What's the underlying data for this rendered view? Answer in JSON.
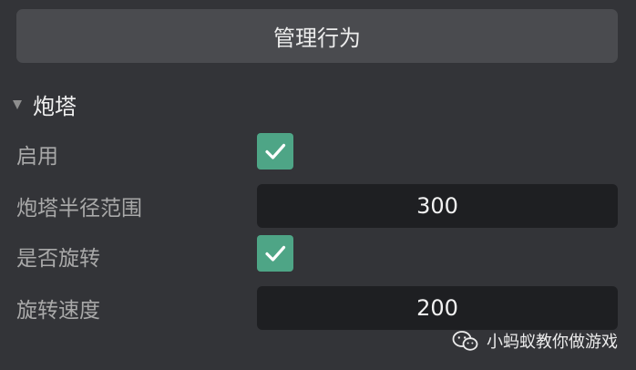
{
  "header": {
    "manage_behavior_label": "管理行为"
  },
  "section": {
    "title": "炮塔",
    "rows": [
      {
        "label": "启用",
        "type": "checkbox",
        "checked": true
      },
      {
        "label": "炮塔半径范围",
        "type": "number",
        "value": "300"
      },
      {
        "label": "是否旋转",
        "type": "checkbox",
        "checked": true
      },
      {
        "label": "旋转速度",
        "type": "number",
        "value": "200"
      }
    ]
  },
  "watermark": {
    "text": "小蚂蚁教你做游戏",
    "icon": "wechat-icon"
  },
  "colors": {
    "background": "#333438",
    "button": "#4a4b4f",
    "checkbox_checked": "#4ea586",
    "field": "#1e1f22"
  }
}
